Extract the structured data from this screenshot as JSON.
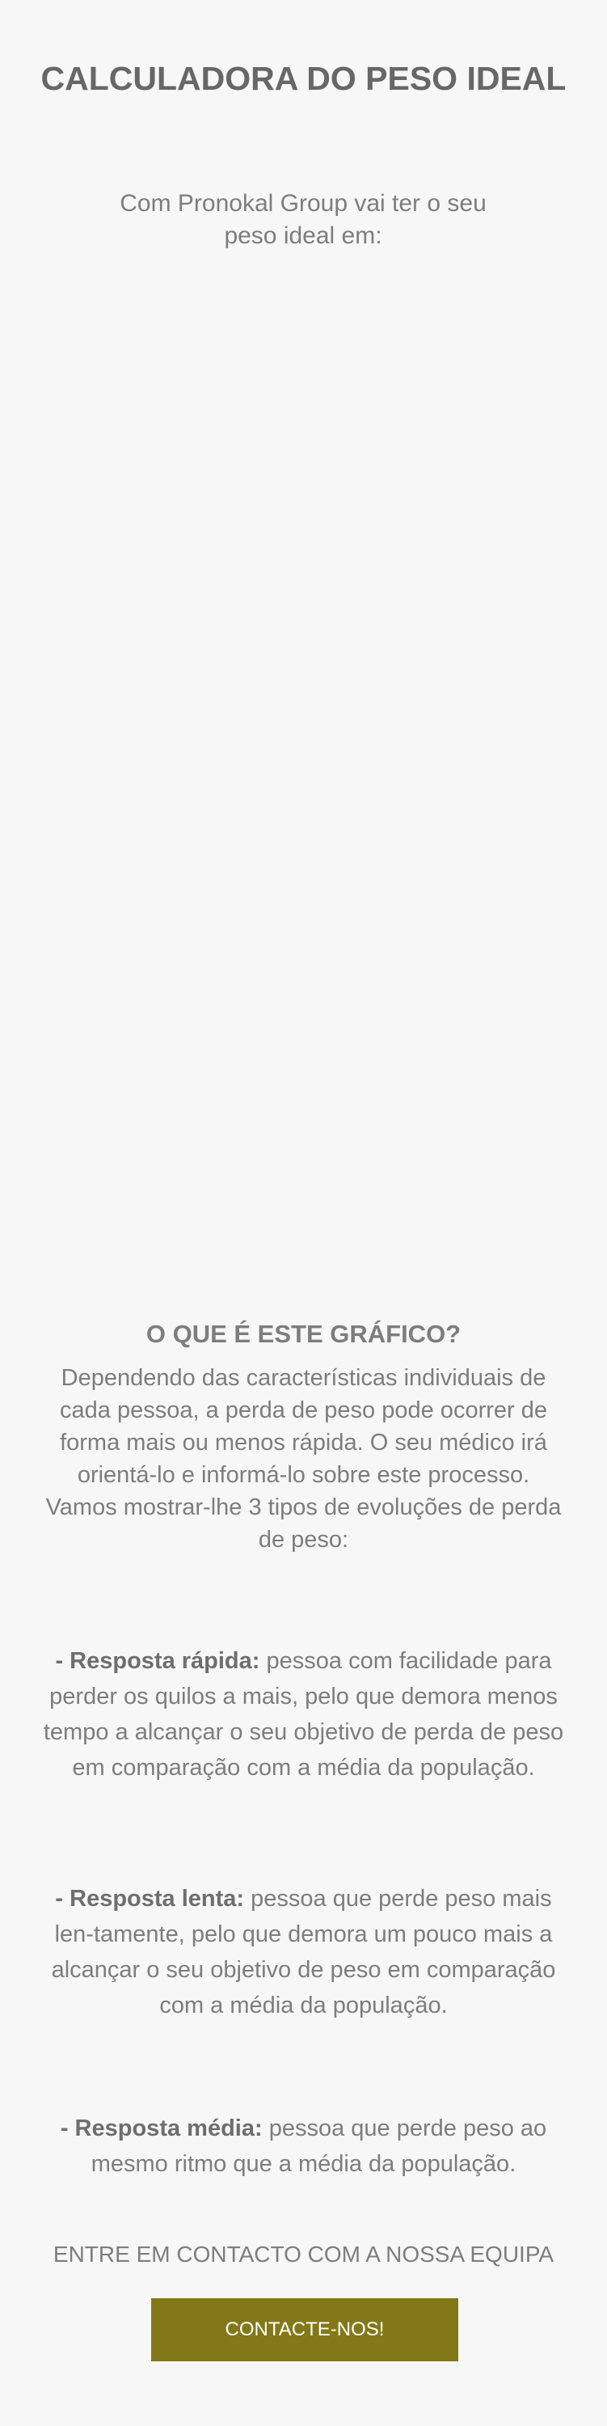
{
  "header": {
    "title": "CALCULADORA DO PESO IDEAL"
  },
  "intro": {
    "text": "Com Pronokal Group vai ter o seu peso ideal em:"
  },
  "explanation": {
    "title": "O QUE É ESTE GRÁFICO?",
    "text": "Dependendo das características individuais de cada pessoa, a perda de peso pode ocorrer de forma mais ou menos rápida. O seu médico irá orientá-lo e informá-lo sobre este processo. Vamos mostrar-lhe 3 tipos de evoluções de perda de peso:"
  },
  "responses": {
    "fast": {
      "label": "- Resposta rápida:",
      "text": " pessoa com facilidade para perder os quilos a mais, pelo que demora menos tempo a alcançar o seu objetivo de perda de peso em comparação com a média da população."
    },
    "slow": {
      "label": "- Resposta lenta:",
      "text": " pessoa que perde peso mais len-tamente, pelo que demora um pouco mais a alcançar o seu objetivo de peso em comparação com a média da população."
    },
    "medium": {
      "label": "- Resposta média:",
      "text": " pessoa que perde peso ao mesmo ritmo que a média da população."
    }
  },
  "contact": {
    "text": "ENTRE EM CONTACTO COM A NOSSA EQUIPA",
    "button_label": "CONTACTE-NOS!"
  },
  "colors": {
    "background": "#f7f7f7",
    "title_text": "#676767",
    "body_text": "#7d7d7d",
    "button_background": "#837818",
    "button_text": "#ffffff"
  }
}
